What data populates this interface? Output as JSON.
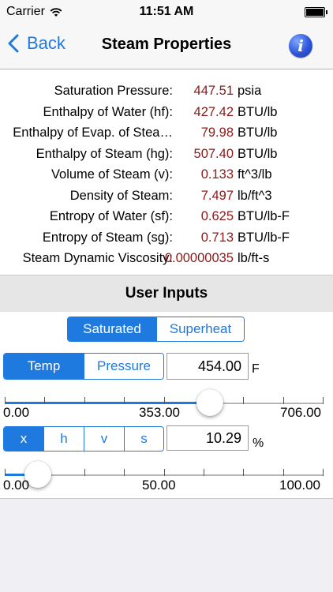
{
  "status": {
    "carrier": "Carrier",
    "time": "11:51 AM"
  },
  "nav": {
    "back_label": "Back",
    "title": "Steam Properties",
    "info_label": "i"
  },
  "properties": [
    {
      "label": "Saturation Pressure:",
      "value": "447.51",
      "unit": "psia"
    },
    {
      "label": "Enthalpy of Water (hf):",
      "value": "427.42",
      "unit": "BTU/lb"
    },
    {
      "label": "Enthalpy of Evap. of Stea…",
      "value": "79.98",
      "unit": "BTU/lb"
    },
    {
      "label": "Enthalpy of Steam (hg):",
      "value": "507.40",
      "unit": "BTU/lb"
    },
    {
      "label": "Volume of Steam (v):",
      "value": "0.133",
      "unit": "ft^3/lb"
    },
    {
      "label": "Density of Steam:",
      "value": "7.497",
      "unit": "lb/ft^3"
    },
    {
      "label": "Entropy of Water (sf):",
      "value": "0.625",
      "unit": "BTU/lb-F"
    },
    {
      "label": "Entropy of Steam (sg):",
      "value": "0.713",
      "unit": "BTU/lb-F"
    },
    {
      "label": "Steam Dynamic Viscosity:",
      "value": "0.00000035",
      "unit": "lb/ft-s"
    }
  ],
  "section_title": "User Inputs",
  "mode_toggle": {
    "options": [
      "Saturated",
      "Superheat"
    ],
    "selected": "Saturated"
  },
  "input_type_toggle": {
    "options": [
      "Temp",
      "Pressure"
    ],
    "selected": "Temp"
  },
  "primary_input": {
    "value": "454.00",
    "unit": "F"
  },
  "primary_slider": {
    "min_label": "0.00",
    "mid_label": "353.00",
    "max_label": "706.00",
    "min": 0,
    "max": 706,
    "value": 454
  },
  "quality_toggle": {
    "options": [
      "x",
      "h",
      "v",
      "s"
    ],
    "selected": "x"
  },
  "secondary_input": {
    "value": "10.29",
    "unit": "%"
  },
  "secondary_slider": {
    "min_label": "0.00",
    "mid_label": "50.00",
    "max_label": "100.00",
    "min": 0,
    "max": 100,
    "value": 10.29
  },
  "colors": {
    "accent": "#1f7ae0",
    "value_text": "#8b1a1a",
    "panel_bg": "#efeff4"
  }
}
